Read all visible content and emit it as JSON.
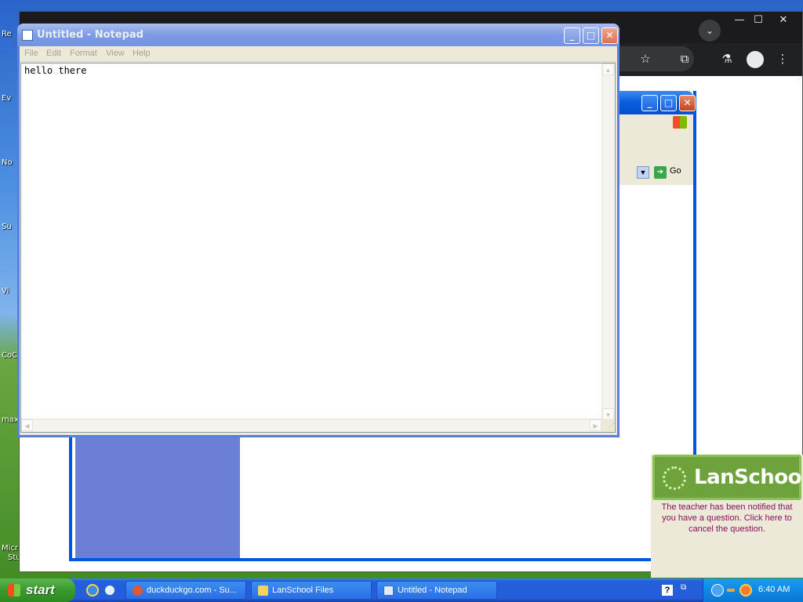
{
  "desktop": {
    "labels": [
      "Re",
      "Ev",
      "No",
      "Su",
      "Vi",
      "CoC",
      "max",
      "Micr",
      "Stu"
    ]
  },
  "ie": {
    "go_label": "Go"
  },
  "notepad": {
    "title": "Untitled - Notepad",
    "menu": [
      "File",
      "Edit",
      "Format",
      "View",
      "Help"
    ],
    "content": "hello there"
  },
  "lanschool": {
    "logo": "LanSchool",
    "message": "The teacher has been notified that you have a question. Click here to cancel the question."
  },
  "taskbar": {
    "start_label": "start",
    "tasks": [
      "duckduckgo.com - Su...",
      "LanSchool Files",
      "Untitled - Notepad"
    ],
    "clock": "6:40 AM"
  },
  "colors": {
    "notepad_title_inactive": "#7d9ae4",
    "lanschool_green": "#6ea23c",
    "lanschool_message": "#8a0f5a",
    "taskbar_blue": "#245edb"
  }
}
